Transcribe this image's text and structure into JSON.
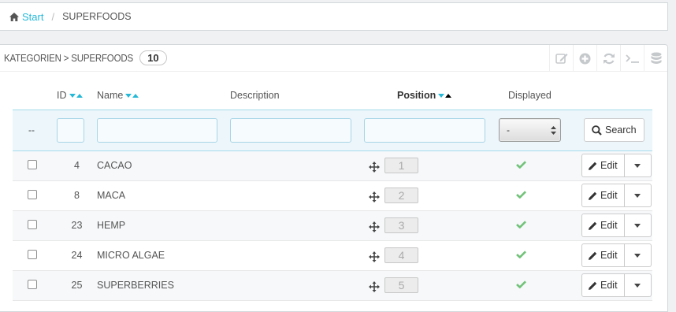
{
  "breadcrumb": {
    "home": "Start",
    "separator": "/",
    "current": "SUPERFOODS"
  },
  "panel": {
    "title": "KATEGORIEN > SUPERFOODS",
    "count": "10"
  },
  "toolbar": {
    "icons": [
      "edit-icon",
      "add-icon",
      "refresh-icon",
      "terminal-icon",
      "database-icon"
    ]
  },
  "columns": {
    "id": "ID",
    "name": "Name",
    "description": "Description",
    "position": "Position",
    "displayed": "Displayed"
  },
  "filter": {
    "bulk_label": "--",
    "displayed_value": "-",
    "search_label": "Search"
  },
  "rows": [
    {
      "id": "4",
      "name": "CACAO",
      "position": "1",
      "displayed": true
    },
    {
      "id": "8",
      "name": "MACA",
      "position": "2",
      "displayed": true
    },
    {
      "id": "23",
      "name": "HEMP",
      "position": "3",
      "displayed": true
    },
    {
      "id": "24",
      "name": "MICRO ALGAE",
      "position": "4",
      "displayed": true
    },
    {
      "id": "25",
      "name": "SUPERBERRIES",
      "position": "5",
      "displayed": true
    }
  ],
  "row_action": {
    "edit_label": "Edit"
  },
  "colors": {
    "accent": "#25b9d7",
    "check": "#72c279",
    "filter_bg": "#ecf6fb"
  }
}
